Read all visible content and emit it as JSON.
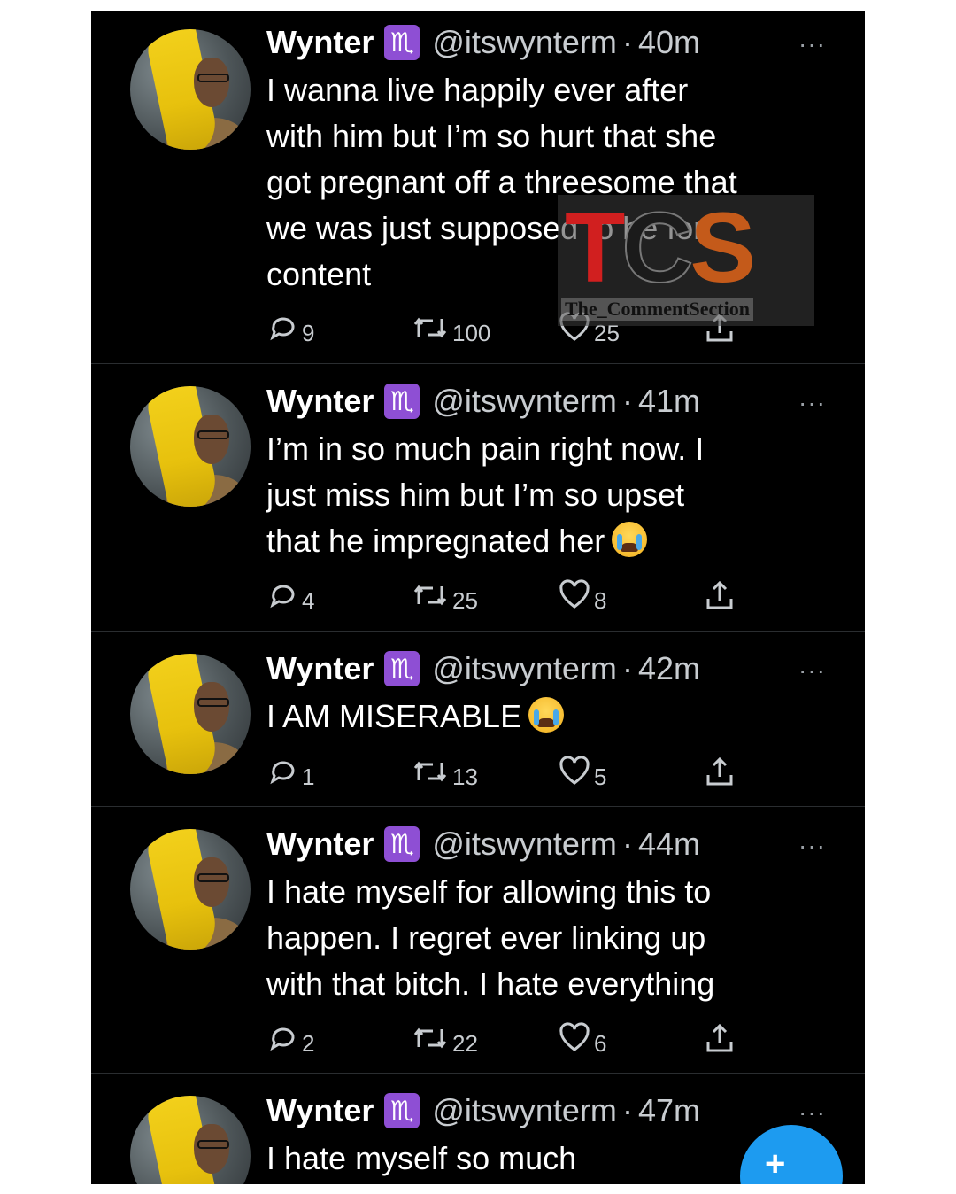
{
  "tweets": [
    {
      "name": "Wynter",
      "zodiac": "♏",
      "handle": "@itswynterm",
      "separator": "·",
      "time": "40m",
      "more": "···",
      "text": "I wanna live happily ever after\nwith him but I’m so hurt that she\ngot pregnant off a threesome that\nwe was just supposed to be for\ncontent",
      "emoji": "",
      "replies": "9",
      "retweets": "100",
      "likes": "25"
    },
    {
      "name": "Wynter",
      "zodiac": "♏",
      "handle": "@itswynterm",
      "separator": "·",
      "time": "41m",
      "more": "···",
      "text": "I’m in so much pain right now. I\njust miss him but I’m so upset\nthat he impregnated her",
      "emoji": "crying-face",
      "replies": "4",
      "retweets": "25",
      "likes": "8"
    },
    {
      "name": "Wynter",
      "zodiac": "♏",
      "handle": "@itswynterm",
      "separator": "·",
      "time": "42m",
      "more": "···",
      "text": "I AM MISERABLE",
      "emoji": "crying-face",
      "replies": "1",
      "retweets": "13",
      "likes": "5"
    },
    {
      "name": "Wynter",
      "zodiac": "♏",
      "handle": "@itswynterm",
      "separator": "·",
      "time": "44m",
      "more": "···",
      "text": "I hate myself for allowing this to\nhappen. I regret ever linking up\nwith that bitch. I hate everything",
      "emoji": "",
      "replies": "2",
      "retweets": "22",
      "likes": "6"
    },
    {
      "name": "Wynter",
      "zodiac": "♏",
      "handle": "@itswynterm",
      "separator": "·",
      "time": "47m",
      "more": "···",
      "text": "I hate myself so much",
      "emoji": "",
      "replies": "",
      "retweets": "",
      "likes": ""
    }
  ],
  "watermark": {
    "letters": [
      "T",
      "C",
      "S"
    ],
    "caption": "The_CommentSection"
  },
  "fab": {
    "icon": "compose-tweet-icon",
    "label": "+"
  },
  "colors": {
    "background": "#000000",
    "accent": "#1d9bf0",
    "zodiac_badge": "#8e4fd4",
    "secondary_text": "#c8ccd0"
  }
}
